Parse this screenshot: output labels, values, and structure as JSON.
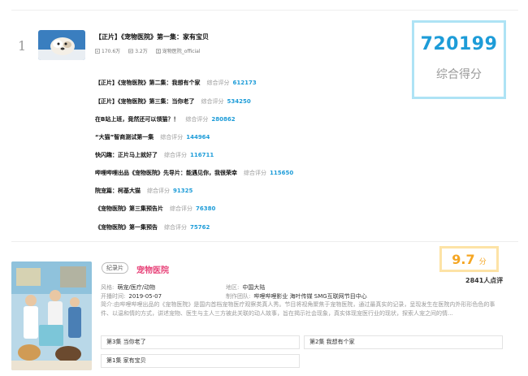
{
  "top_result": {
    "rank": "1",
    "title": "【正片】《宠物医院》第一集：家有宝贝",
    "plays": "170.6万",
    "danmaku": "3.2万",
    "uploader": "宠物医院_official",
    "score_value": "720199",
    "score_label": "综合得分"
  },
  "results": [
    {
      "title": "【正片】《宠物医院》第二集：我想有个家",
      "score_label": "综合评分",
      "score": "612173"
    },
    {
      "title": "【正片】《宠物医院》第三集：当你老了",
      "score_label": "综合评分",
      "score": "534250"
    },
    {
      "title": "在B站上班，竟然还可以领猫？！",
      "score_label": "综合评分",
      "score": "280862"
    },
    {
      "title": "“大猫”智商测试第一集",
      "score_label": "综合评分",
      "score": "144964"
    },
    {
      "title": "快闪趣：正片马上就好了",
      "score_label": "综合评分",
      "score": "116711"
    },
    {
      "title": "哔哩哔哩出品《宠物医院》先导片：能遇见你，我很荣幸",
      "score_label": "综合评分",
      "score": "115650"
    },
    {
      "title": "院宠篇：柯基大猫",
      "score_label": "综合评分",
      "score": "91325"
    },
    {
      "title": "《宠物医院》第三集预告片",
      "score_label": "综合评分",
      "score": "76380"
    },
    {
      "title": "《宠物医院》第一集预告",
      "score_label": "综合评分",
      "score": "75762"
    }
  ],
  "show": {
    "tag": "纪录片",
    "title": "宠物医院",
    "genre_label": "风格:",
    "genre": "萌宠/医疗/动物",
    "region_label": "地区:",
    "region": "中国大陆",
    "date_label": "开播时间:",
    "date": "2019-05-07",
    "team_label": "制作团队:",
    "team": "哔哩哔哩影业 海叶传媒 SMG互联网节目中心",
    "desc_label": "简介:",
    "desc": "由哔哩哔哩出品的《宠物医院》是国内首档宠物医疗观察类真人秀。节目将视角聚焦于宠物医院，通过最真实的记录，呈现发生在医院内外形形色色的事件、以温和情的方式，讲述宠物、医生与主人三方被此关联的动人故事，旨在揭示社会现象，真实体现宠医行业的现状，探索人宠之间的情...",
    "rating": "9.7",
    "rating_unit": "分",
    "rating_count": "2841人点评",
    "episodes": [
      {
        "label": "第3集 当你老了"
      },
      {
        "label": "第2集 我想有个家"
      },
      {
        "label": "第1集 家有宝贝"
      }
    ]
  }
}
